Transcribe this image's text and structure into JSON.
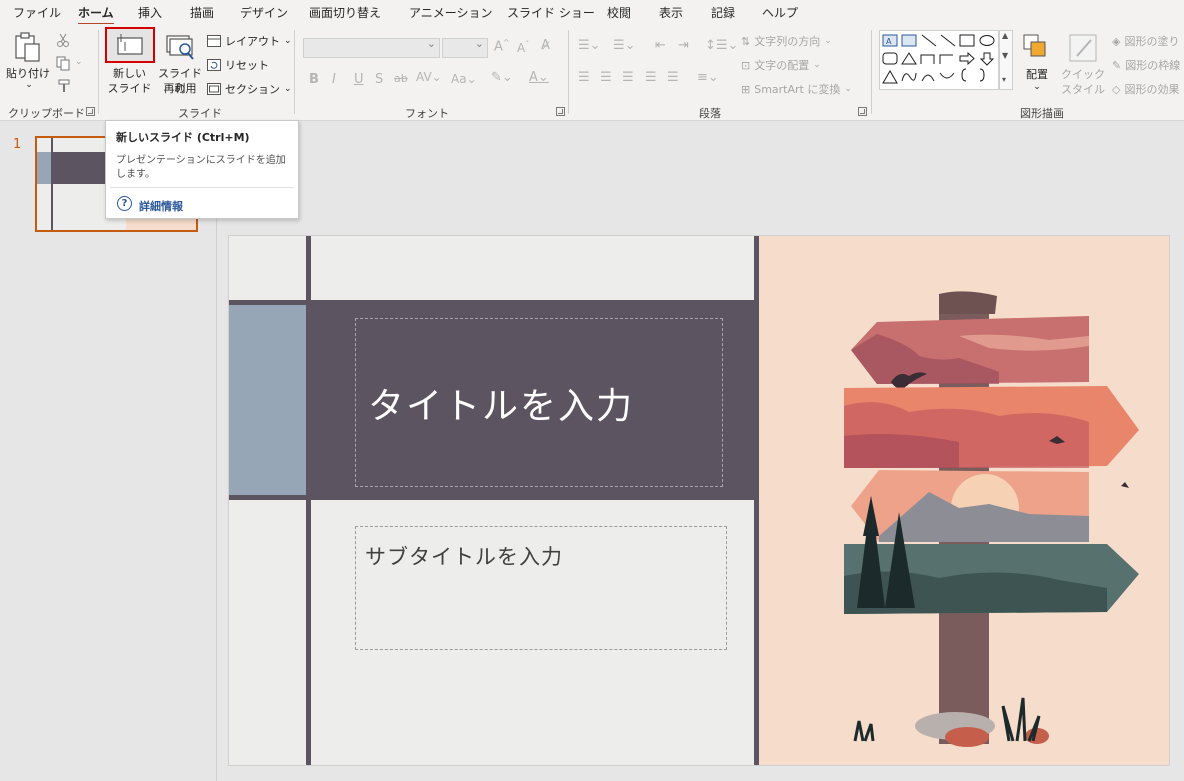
{
  "tabs": [
    "ファイル",
    "ホーム",
    "挿入",
    "描画",
    "デザイン",
    "画面切り替え",
    "アニメーション",
    "スライド ショー",
    "校閲",
    "表示",
    "記録",
    "ヘルプ"
  ],
  "active_tab": "ホーム",
  "ribbon": {
    "clipboard": {
      "group_label": "クリップボード",
      "paste": "貼り付け"
    },
    "slides": {
      "group_label": "スライド",
      "new_slide_1": "新しい",
      "new_slide_2": "スライド",
      "reuse_1": "スライドの",
      "reuse_2": "再利用",
      "layout": "レイアウト",
      "reset": "リセット",
      "section": "セクション"
    },
    "font": {
      "group_label": "フォント",
      "bold": "B",
      "italic": "I",
      "underline": "U",
      "shadow": "S",
      "strike": "ab"
    },
    "paragraph": {
      "group_label": "段落",
      "text_direction": "文字列の方向",
      "align_text": "文字の配置",
      "smartart": "SmartArt に変換"
    },
    "drawing": {
      "group_label": "図形描画",
      "arrange": "配置",
      "quick_style_1": "クイック",
      "quick_style_2": "スタイル",
      "shape_fill": "図形の塗り",
      "shape_outline": "図形の枠線",
      "shape_effects": "図形の効果"
    }
  },
  "tooltip": {
    "title": "新しいスライド (Ctrl+M)",
    "description": "プレゼンテーションにスライドを追加します。",
    "link": "詳細情報"
  },
  "thumbnails": {
    "slide_number": "1"
  },
  "slide": {
    "title_placeholder": "タイトルを入力",
    "subtitle_placeholder": "サブタイトルを入力"
  },
  "colors": {
    "accent": "#b7472a",
    "slide_bar": "#5d5461",
    "slide_bg": "#edeeeb",
    "illustration_bg": "#f6dccb",
    "left_block": "#97a6b6"
  }
}
